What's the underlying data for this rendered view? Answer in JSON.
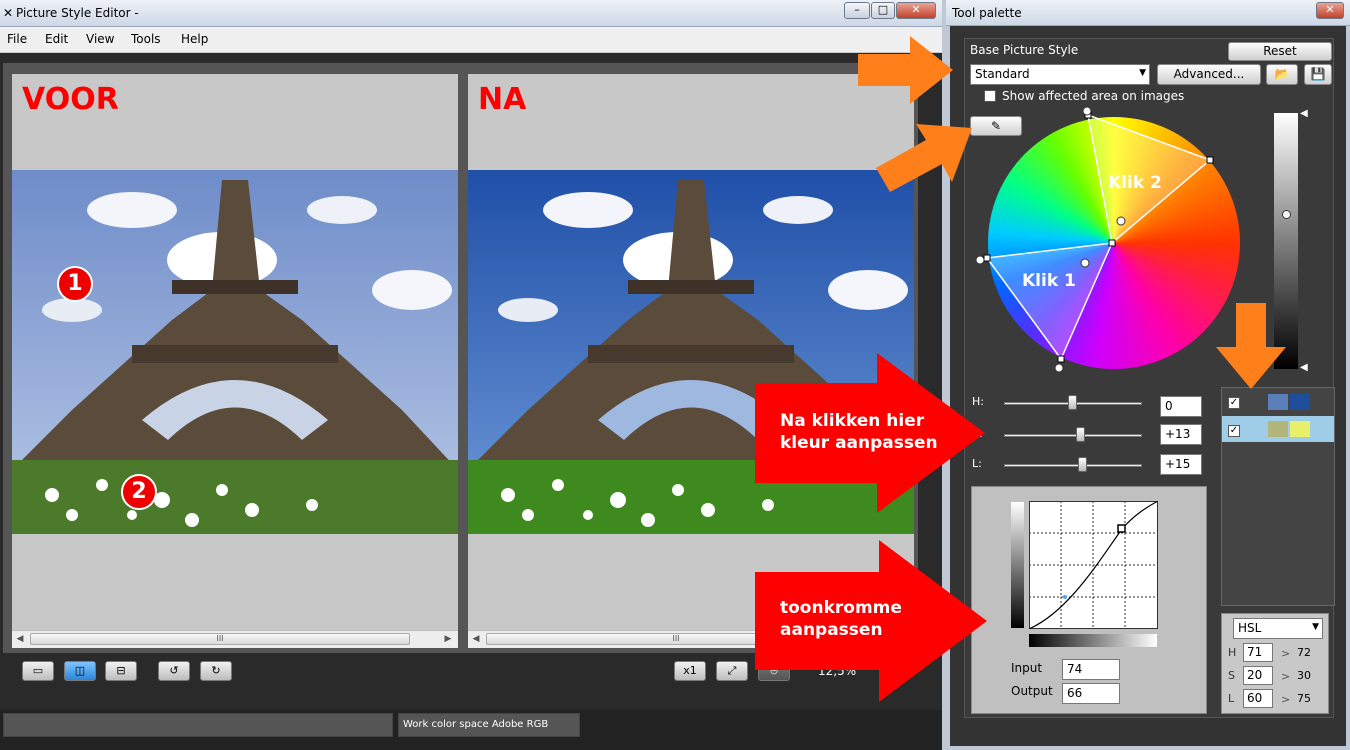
{
  "editor": {
    "title": "Picture Style Editor -",
    "menu": [
      "File",
      "Edit",
      "View",
      "Tools",
      "Help"
    ],
    "before_label": "VOOR",
    "after_label": "NA",
    "marker1": "1",
    "marker2": "2",
    "zoom": "12,5%",
    "zoom_x1": "x1",
    "status_colorspace": "Work color space  Adobe RGB",
    "scroll_thumb": "III"
  },
  "palette": {
    "title": "Tool palette",
    "base_style_label": "Base Picture Style",
    "reset": "Reset",
    "style_value": "Standard",
    "advanced": "Advanced...",
    "show_affected": "Show affected area on images",
    "wheel_label1": "Klik 1",
    "wheel_label2": "Klik 2",
    "h_label": "H:",
    "s_label": "S:",
    "l_label": "L:",
    "h_value": "0",
    "s_value": "+13",
    "l_value": "+15",
    "input_label": "Input",
    "output_label": "Output",
    "input_value": "74",
    "output_value": "66",
    "color_mode": "HSL",
    "hsl": [
      {
        "k": "H",
        "from": "71",
        "arrow": ">",
        "to": "72"
      },
      {
        "k": "S",
        "from": "20",
        "arrow": ">",
        "to": "30"
      },
      {
        "k": "L",
        "from": "60",
        "arrow": ">",
        "to": "75"
      }
    ],
    "colors": {
      "swatch1a": "#5a7fb9",
      "swatch1b": "#1e4e9c",
      "swatch2a": "#b3b67a",
      "swatch2b": "#e8f06a"
    }
  },
  "annotations": {
    "color_tip": "Na klikken hier\nkleur aanpassen",
    "curve_tip": "toonkromme\naanpassen"
  }
}
